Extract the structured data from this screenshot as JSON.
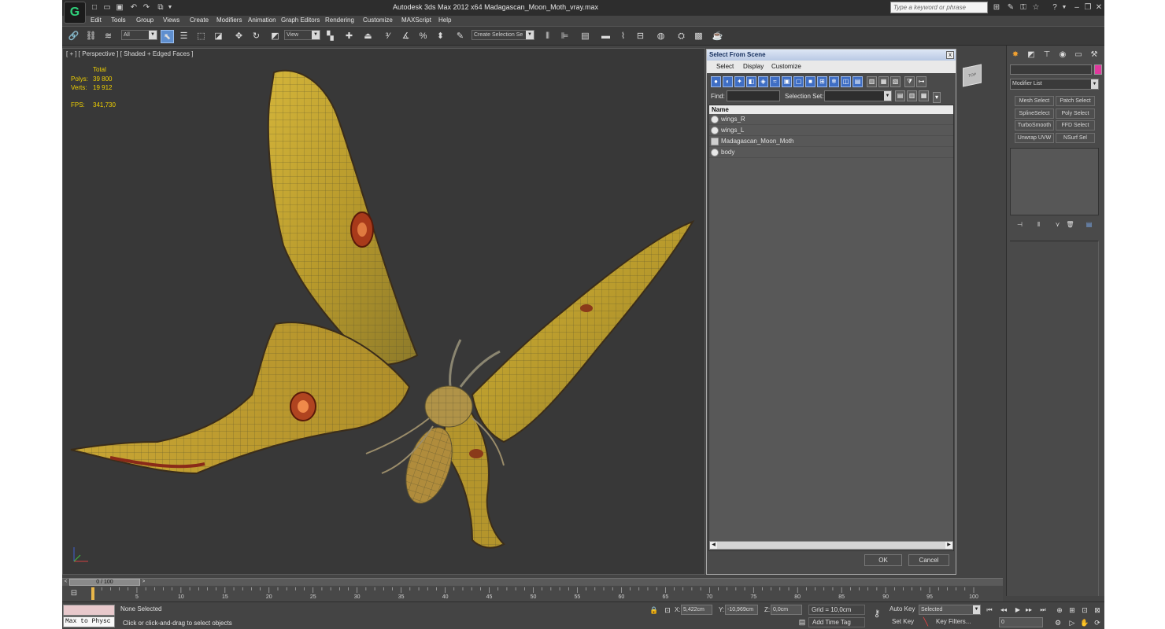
{
  "window": {
    "title": "Autodesk 3ds Max  2012 x64    Madagascan_Moon_Moth_vray.max",
    "search_placeholder": "Type a keyword or phrase",
    "logo": "G"
  },
  "menu": [
    "Edit",
    "Tools",
    "Group",
    "Views",
    "Create",
    "Modifiers",
    "Animation",
    "Graph Editors",
    "Rendering",
    "Customize",
    "MAXScript",
    "Help"
  ],
  "toolbar": {
    "selection_filter": "All",
    "reference_coord": "View",
    "named_selection": "Create Selection Se"
  },
  "viewport": {
    "label": "[ + ] [ Perspective ] [ Shaded + Edged Faces ]",
    "stats_header": "Total",
    "polys_label": "Polys:",
    "polys_value": "39 800",
    "verts_label": "Verts:",
    "verts_value": "19 912",
    "fps_label": "FPS:",
    "fps_value": "341,730",
    "viewcube_label": "TOP"
  },
  "dialog": {
    "title": "Select From Scene",
    "close": "x",
    "menu": [
      "Select",
      "Display",
      "Customize"
    ],
    "find_label": "Find:",
    "selection_set_label": "Selection Set:",
    "column_name": "Name",
    "objects": [
      {
        "name": "wings_R",
        "type": "mesh"
      },
      {
        "name": "wings_L",
        "type": "mesh"
      },
      {
        "name": "Madagascan_Moon_Moth",
        "type": "group"
      },
      {
        "name": "body",
        "type": "mesh"
      }
    ],
    "ok": "OK",
    "cancel": "Cancel"
  },
  "command_panel": {
    "modifier_list": "Modifier List",
    "modifiers": [
      [
        "Mesh Select",
        "Patch Select"
      ],
      [
        "SplineSelect",
        "Poly Select"
      ],
      [
        "TurboSmooth",
        "FFD Select"
      ],
      [
        "Unwrap UVW",
        "NSurf Sel"
      ]
    ],
    "object_color": "#e0399d"
  },
  "timeline": {
    "frame_display": "0 / 100",
    "tick_labels": [
      "0",
      "5",
      "10",
      "15",
      "20",
      "25",
      "30",
      "35",
      "40",
      "45",
      "50",
      "55",
      "60",
      "65",
      "70",
      "75",
      "80",
      "85",
      "90",
      "95",
      "100"
    ]
  },
  "status": {
    "listener": "Max to Physc",
    "selection": "None Selected",
    "prompt": "Click or click-and-drag to select objects",
    "x_label": "X:",
    "x_value": "5,422cm",
    "y_label": "Y:",
    "y_value": "-10,969cm",
    "z_label": "Z:",
    "z_value": "0,0cm",
    "grid": "Grid = 10,0cm",
    "add_time_tag": "Add Time Tag",
    "auto_key": "Auto Key",
    "set_key": "Set Key",
    "key_mode": "Selected",
    "key_filters": "Key Filters...",
    "current_frame": "0"
  }
}
